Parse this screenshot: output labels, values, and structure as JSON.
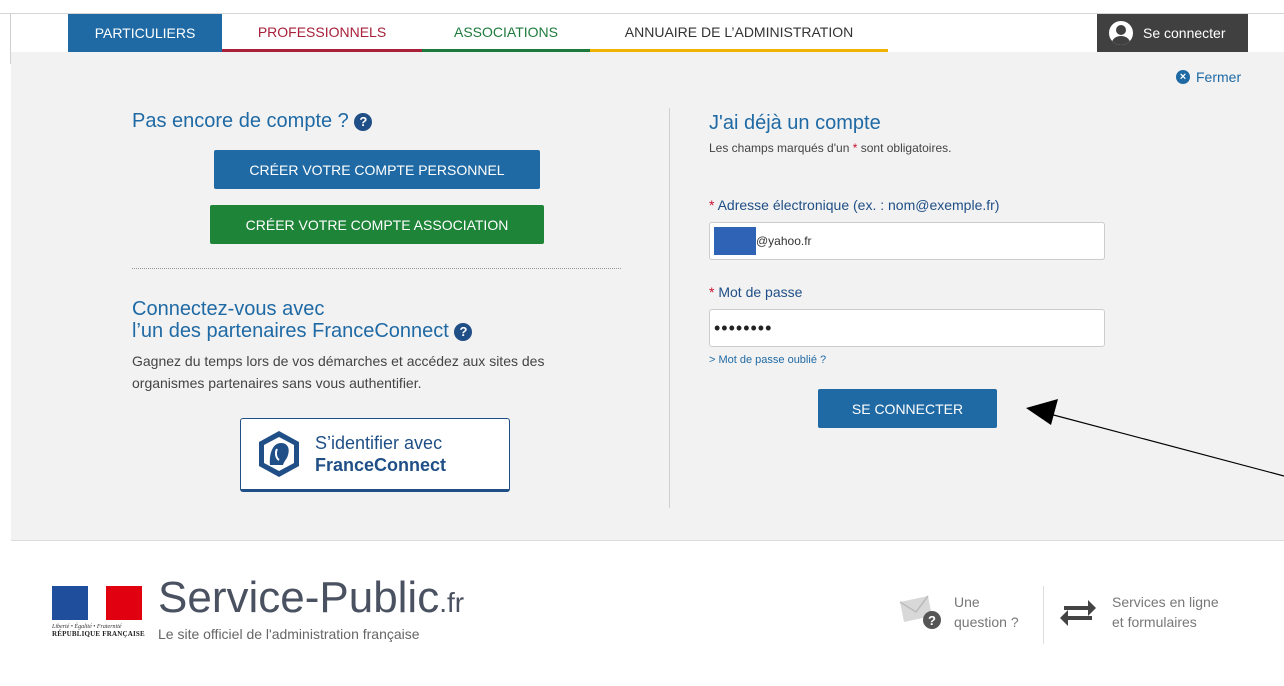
{
  "nav": {
    "tabs": [
      {
        "label": "PARTICULIERS"
      },
      {
        "label": "PROFESSIONNELS"
      },
      {
        "label": "ASSOCIATIONS"
      },
      {
        "label": "ANNUAIRE DE L’ADMINISTRATION"
      }
    ],
    "login_label": "Se connecter"
  },
  "panel": {
    "close_label": "Fermer",
    "new_account": {
      "title": "Pas encore de compte ?",
      "btn_personal": "CRÉER VOTRE COMPTE PERSONNEL",
      "btn_association": "CRÉER VOTRE COMPTE ASSOCIATION"
    },
    "franceconnect": {
      "title_line1": "Connectez-vous avec",
      "title_line2": "l’un des partenaires FranceConnect",
      "description": "Gagnez du temps lors de vos démarches et accédez aux sites des organismes partenaires sans vous authentifier.",
      "btn_line1": "S’identifier avec",
      "btn_line2": "FranceConnect"
    },
    "existing": {
      "title": "J'ai déjà un compte",
      "required_note_before": "Les champs marqués d'un",
      "required_star": "*",
      "required_note_after": "sont obligatoires.",
      "email_label": "Adresse électronique (ex. : nom@exemple.fr)",
      "email_value": "@yahoo.fr",
      "password_label": "Mot de passe",
      "password_value": "••••••••",
      "forgot_label": "> Mot de passe oublié ?",
      "submit_label": "SE CONNECTER"
    }
  },
  "footer": {
    "motto": "Liberté • Égalité • Fraternité",
    "republic": "RÉPUBLIQUE FRANÇAISE",
    "site_name": "Service-Public",
    "site_tld": ".fr",
    "site_subtitle": "Le site officiel de l'administration française",
    "question_line1": "Une",
    "question_line2": "question ?",
    "services_line1": "Services en ligne",
    "services_line2": "et formulaires"
  },
  "colors": {
    "brand_blue": "#1f6aa5",
    "green": "#1d8438",
    "pro_red": "#a8203a",
    "annuaire_yellow": "#f0b400"
  },
  "icons": [
    "user-icon",
    "close-circle-icon",
    "help-icon",
    "franceconnect-icon",
    "mail-question-icon",
    "exchange-arrows-icon",
    "marianne-logo"
  ]
}
